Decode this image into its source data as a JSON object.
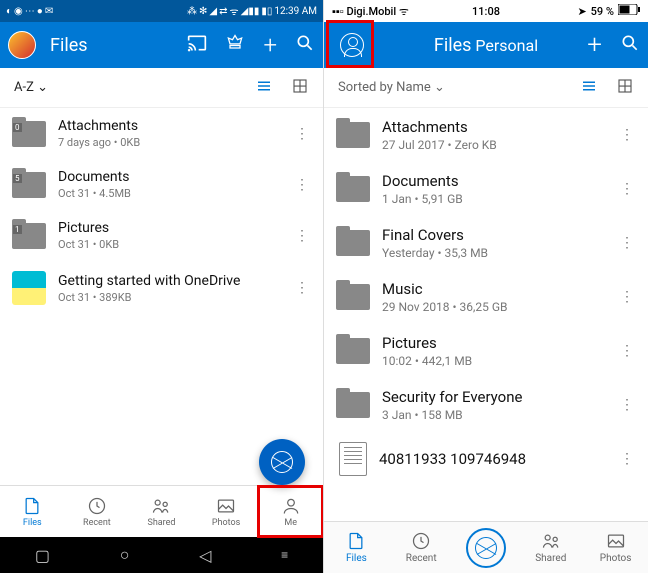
{
  "left": {
    "status": {
      "time": "12:39 AM"
    },
    "header": {
      "title": "Files"
    },
    "sort": "A-Z",
    "items": [
      {
        "name": "Attachments",
        "meta": "7 days ago • 0KB",
        "badge": "0",
        "kind": "folder"
      },
      {
        "name": "Documents",
        "meta": "Oct 31 • 4.5MB",
        "badge": "5",
        "kind": "folder"
      },
      {
        "name": "Pictures",
        "meta": "Oct 31 • 0KB",
        "badge": "1",
        "kind": "folder"
      },
      {
        "name": "Getting started with OneDrive",
        "meta": "Oct 31 • 389KB",
        "kind": "thumb"
      }
    ],
    "nav": [
      {
        "label": "Files",
        "active": true
      },
      {
        "label": "Recent"
      },
      {
        "label": "Shared"
      },
      {
        "label": "Photos"
      },
      {
        "label": "Me",
        "highlight": true
      }
    ]
  },
  "right": {
    "status": {
      "carrier": "Digi.Mobil",
      "time": "11:08",
      "battery": "59 %"
    },
    "header": {
      "title": "Files",
      "subtitle": "Personal"
    },
    "sort": "Sorted by Name",
    "items": [
      {
        "name": "Attachments",
        "meta": "27 Jul 2017 • Zero KB"
      },
      {
        "name": "Documents",
        "meta": "1 Jan • 5,91 GB"
      },
      {
        "name": "Final Covers",
        "meta": "Yesterday • 35,3 MB"
      },
      {
        "name": "Music",
        "meta": "29 Nov 2018 • 36,25 GB"
      },
      {
        "name": "Pictures",
        "meta": "10:02 • 442,1 MB"
      },
      {
        "name": "Security for Everyone",
        "meta": "3 Jan • 158 MB"
      },
      {
        "name": "40811933     109746948",
        "meta": "",
        "kind": "file"
      }
    ],
    "nav": [
      {
        "label": "Files",
        "active": true
      },
      {
        "label": "Recent"
      },
      {
        "label": "",
        "camera": true
      },
      {
        "label": "Shared"
      },
      {
        "label": "Photos"
      }
    ]
  }
}
